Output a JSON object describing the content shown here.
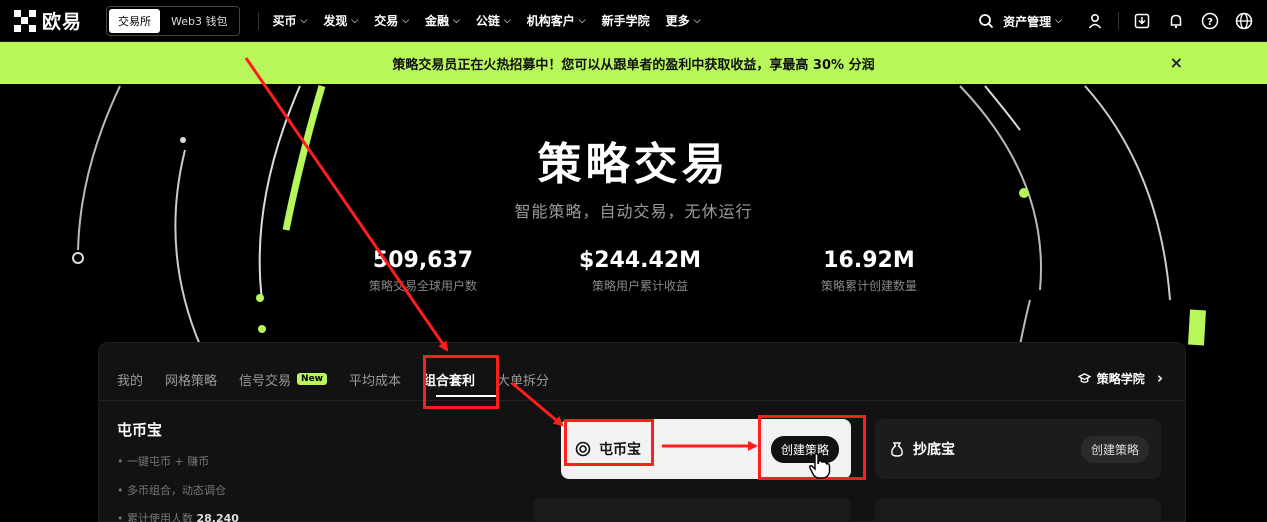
{
  "brand": {
    "name": "欧易"
  },
  "mode_switch": {
    "exchange": "交易所",
    "web3": "Web3 钱包"
  },
  "nav": {
    "items": [
      {
        "label": "买币",
        "dropdown": true
      },
      {
        "label": "发现",
        "dropdown": true
      },
      {
        "label": "交易",
        "dropdown": true
      },
      {
        "label": "金融",
        "dropdown": true
      },
      {
        "label": "公链",
        "dropdown": true
      },
      {
        "label": "机构客户",
        "dropdown": true
      },
      {
        "label": "新手学院",
        "dropdown": false
      },
      {
        "label": "更多",
        "dropdown": true
      }
    ],
    "asset_management": "资产管理"
  },
  "banner": {
    "text": "策略交易员正在火热招募中！您可以从跟单者的盈利中获取收益，享最高 30% 分润",
    "close": "×"
  },
  "hero": {
    "title": "策略交易",
    "subtitle": "智能策略，自动交易，无休运行",
    "stats": [
      {
        "value": "509,637",
        "label": "策略交易全球用户数"
      },
      {
        "value": "$244.42M",
        "label": "策略用户累计收益"
      },
      {
        "value": "16.92M",
        "label": "策略累计创建数量"
      }
    ]
  },
  "tabs": {
    "items": [
      "我的",
      "网格策略",
      "信号交易",
      "平均成本",
      "组合套利",
      "大单拆分"
    ],
    "new_badge": "New",
    "active": "组合套利",
    "academy": "策略学院"
  },
  "side": {
    "title": "屯币宝",
    "bullets": [
      "一键屯币 + 赚币",
      "多币组合，动态调仓"
    ],
    "users_label": "累计使用人数",
    "users_count": "28,240"
  },
  "cards": [
    {
      "name": "屯币宝",
      "button": "创建策略",
      "highlighted": true
    },
    {
      "name": "抄底宝",
      "button": "创建策略",
      "highlighted": false
    }
  ],
  "colors": {
    "accent": "#b7f75a",
    "annotation": "#ff1d1d"
  }
}
